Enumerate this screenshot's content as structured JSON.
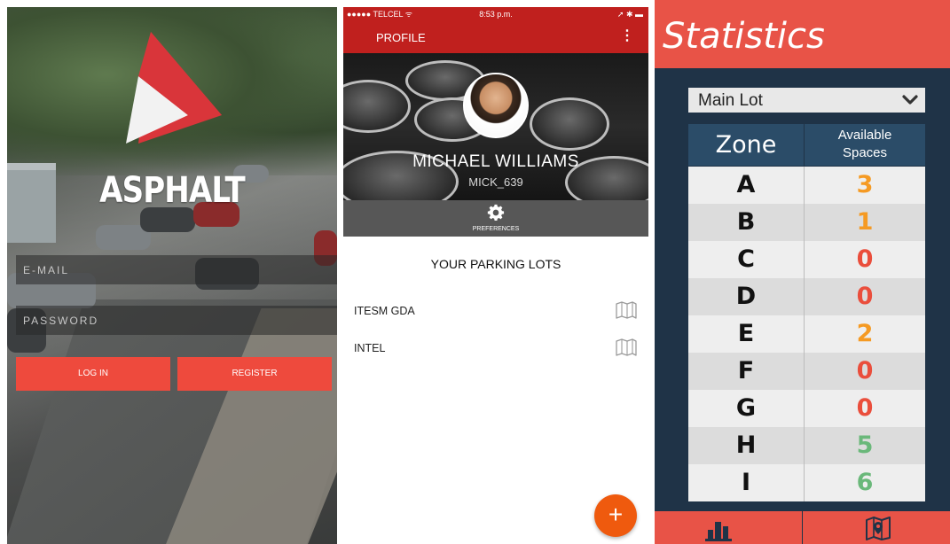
{
  "login": {
    "app_name": "ASPHALT",
    "email_placeholder": "E-MAIL",
    "password_placeholder": "PASSWORD",
    "login_label": "LOG IN",
    "register_label": "REGISTER",
    "colors": {
      "brand_red": "#ee4a3d",
      "logo_red": "#d9353a"
    }
  },
  "profile": {
    "statusbar": {
      "carrier": "●●●●● TELCEL ᯤ",
      "time": "8:53 p.m.",
      "right": "➚ ✱ ▬"
    },
    "title": "PROFILE",
    "menu_icon": "⋮",
    "user_name": "MICHAEL WILLIAMS",
    "username": "MICK_639",
    "preferences_label": "PREFERENCES",
    "lots_title": "YOUR PARKING LOTS",
    "lots": [
      {
        "name": "ITESM GDA"
      },
      {
        "name": "INTEL"
      }
    ],
    "fab_label": "+",
    "colors": {
      "appbar": "#c0201e",
      "fab": "#ef5a0e"
    }
  },
  "stats": {
    "title": "Statistics",
    "selected_lot": "Main Lot",
    "col_zone": "Zone",
    "col_available_1": "Available",
    "col_available_2": "Spaces",
    "rows": [
      {
        "zone": "A",
        "available": "3",
        "color": "#f59a23"
      },
      {
        "zone": "B",
        "available": "1",
        "color": "#f59a23"
      },
      {
        "zone": "C",
        "available": "0",
        "color": "#ea4e3c"
      },
      {
        "zone": "D",
        "available": "0",
        "color": "#ea4e3c"
      },
      {
        "zone": "E",
        "available": "2",
        "color": "#f59a23"
      },
      {
        "zone": "F",
        "available": "0",
        "color": "#ea4e3c"
      },
      {
        "zone": "G",
        "available": "0",
        "color": "#ea4e3c"
      },
      {
        "zone": "H",
        "available": "5",
        "color": "#6ab87a"
      },
      {
        "zone": "I",
        "available": "6",
        "color": "#6ab87a"
      }
    ],
    "colors": {
      "header": "#e85347",
      "background": "#1f3347",
      "table_head": "#2b4c68",
      "row_odd": "#eeeeee",
      "row_even": "#dcdcdc"
    }
  }
}
